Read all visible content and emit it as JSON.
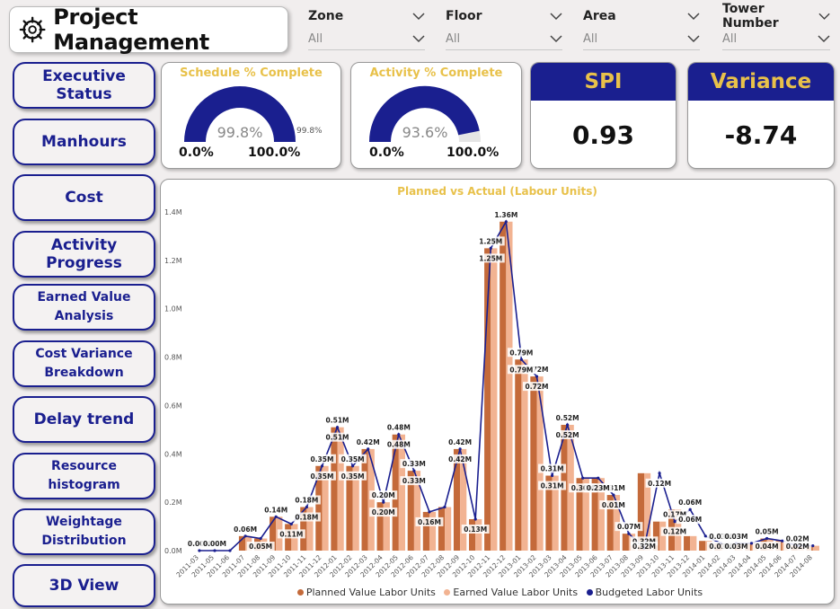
{
  "header": {
    "title": "Project Management",
    "icon": "wheel-gear-icon"
  },
  "filters": [
    {
      "label": "Zone",
      "value": "All"
    },
    {
      "label": "Floor",
      "value": "All"
    },
    {
      "label": "Area",
      "value": "All"
    },
    {
      "label": "Tower Number",
      "value": "All"
    }
  ],
  "nav": [
    {
      "label": "Executive Status"
    },
    {
      "label": "Manhours"
    },
    {
      "label": "Cost"
    },
    {
      "label": "Activity Progress"
    },
    {
      "label": "Earned Value Analysis"
    },
    {
      "label": "Cost Variance Breakdown"
    },
    {
      "label": "Delay trend"
    },
    {
      "label": "Resource histogram"
    },
    {
      "label": "Weightage Distribution"
    },
    {
      "label": "3D View"
    }
  ],
  "gauges": [
    {
      "title": "Schedule % Complete",
      "value_label": "99.8%",
      "value": 99.8,
      "min": "0.0%",
      "max": "100.0%",
      "target_label": "99.8%"
    },
    {
      "title": "Activity % Complete",
      "value_label": "93.6%",
      "value": 93.6,
      "min": "0.0%",
      "max": "100.0%"
    }
  ],
  "kpis": [
    {
      "title": "SPI",
      "value": "0.93"
    },
    {
      "title": "Variance",
      "value": "-8.74"
    }
  ],
  "colors": {
    "accent": "#1a1f8f",
    "gold": "#e8c14a",
    "planned": "#c46a3a",
    "earned": "#f2b392",
    "budgeted": "#1a1f8f"
  },
  "chart_data": {
    "type": "bar",
    "title": "Planned vs Actual (Labour Units)",
    "categories": [
      "2011-03",
      "2011-05",
      "2011-06",
      "2011-07",
      "2011-08",
      "2011-09",
      "2011-10",
      "2011-11",
      "2011-12",
      "2012-01",
      "2012-02",
      "2012-03",
      "2012-04",
      "2012-05",
      "2012-06",
      "2012-07",
      "2012-08",
      "2012-09",
      "2012-10",
      "2012-11",
      "2012-12",
      "2013-01",
      "2013-02",
      "2013-03",
      "2013-04",
      "2013-05",
      "2013-06",
      "2013-07",
      "2013-08",
      "2013-09",
      "2013-10",
      "2013-11",
      "2013-12",
      "2014-01",
      "2014-02",
      "2014-03",
      "2014-04",
      "2014-05",
      "2014-06",
      "2014-07",
      "2014-08"
    ],
    "ylim": [
      0,
      1.4
    ],
    "yticks": [
      "0.0M",
      "0.2M",
      "0.4M",
      "0.6M",
      "0.8M",
      "1.0M",
      "1.2M",
      "1.4M"
    ],
    "series": [
      {
        "name": "Planned Value Labor Units",
        "values": [
          0,
          0,
          0,
          0.06,
          0.05,
          0.14,
          0.11,
          0.18,
          0.35,
          0.51,
          0.35,
          0.42,
          0.2,
          0.48,
          0.33,
          0.16,
          0.18,
          0.42,
          0.13,
          1.25,
          1.36,
          0.79,
          0.72,
          0.31,
          0.52,
          0.3,
          0.3,
          0.23,
          0.07,
          0.32,
          0.12,
          0.17,
          0.06,
          0.04,
          0.03,
          0.03,
          0.03,
          0.05,
          0.04,
          0.02,
          0.02
        ]
      },
      {
        "name": "Earned Value Labor Units",
        "values": [
          0,
          0,
          0,
          0.06,
          0.05,
          0.14,
          0.11,
          0.18,
          0.35,
          0.51,
          0.35,
          0.42,
          0.2,
          0.48,
          0.33,
          0.16,
          0.18,
          0.42,
          0.13,
          1.25,
          1.36,
          0.79,
          0.72,
          0.31,
          0.52,
          0.3,
          0.3,
          0.23,
          0.07,
          0.32,
          0.12,
          0.17,
          0.06,
          0.04,
          0.03,
          0.03,
          0.03,
          0.05,
          0.04,
          0.02,
          0.02
        ]
      },
      {
        "name": "Budgeted Labor Units",
        "values": [
          0,
          0,
          0,
          0.06,
          0.05,
          0.14,
          0.11,
          0.18,
          0.35,
          0.51,
          0.35,
          0.42,
          0.2,
          0.48,
          0.33,
          0.16,
          0.18,
          0.42,
          0.13,
          1.25,
          1.36,
          0.79,
          0.72,
          0.31,
          0.52,
          0.3,
          0.3,
          0.23,
          0.07,
          0.01,
          0.32,
          0.12,
          0.17,
          0.06,
          0.03,
          0.03,
          0.03,
          0.05,
          0.04,
          0.02,
          0.02
        ]
      }
    ],
    "labels_top": [
      "0.00M",
      "0.00M",
      "",
      "0.06M",
      "",
      "0.14M",
      "",
      "0.18M",
      "0.35M",
      "0.51M",
      "0.35M",
      "0.42M",
      "0.20M",
      "0.48M",
      "0.33M",
      "",
      "",
      "0.42M",
      "",
      "1.25M",
      "1.36M",
      "0.79M",
      "0.72M",
      "0.31M",
      "0.52M",
      "",
      "",
      "0.31M",
      "0.07M",
      "0.32M",
      "",
      "0.17M",
      "0.06M",
      "",
      "0.03M",
      "0.03M",
      "",
      "0.05M",
      "",
      "0.02M",
      ""
    ],
    "labels_bottom": [
      "",
      "",
      "",
      "",
      "0.05M",
      "",
      "0.11M",
      "0.18M",
      "0.35M",
      "0.51M",
      "0.35M",
      "",
      "0.20M",
      "0.48M",
      "0.33M",
      "0.16M",
      "",
      "0.42M",
      "0.13M",
      "1.25M",
      "",
      "0.79M",
      "0.72M",
      "0.31M",
      "0.52M",
      "0.30M",
      "0.23M",
      "0.01M",
      "",
      "0.32M",
      "0.12M",
      "0.12M",
      "0.06M",
      "",
      "0.03M",
      "0.03M",
      "",
      "0.04M",
      "",
      "0.02M",
      ""
    ],
    "legend": [
      "Planned Value Labor Units",
      "Earned Value Labor Units",
      "Budgeted Labor Units"
    ]
  }
}
